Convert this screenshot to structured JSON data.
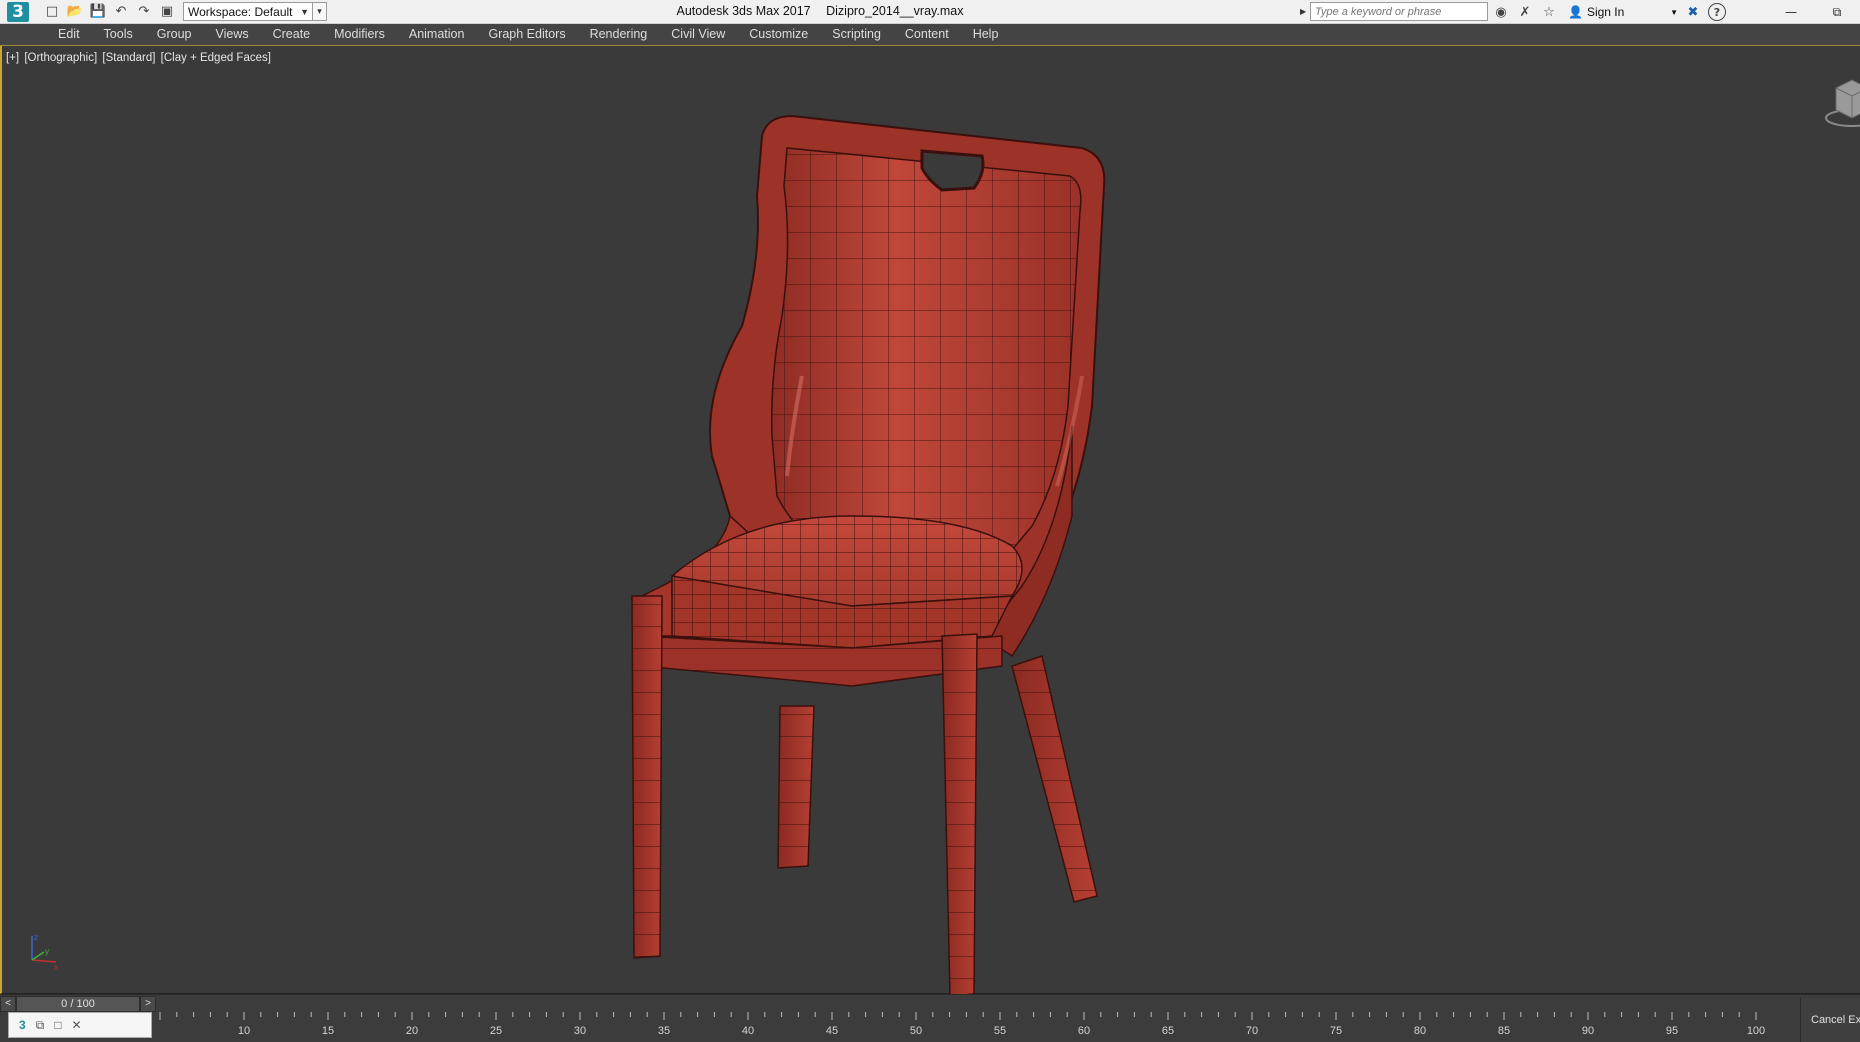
{
  "app": {
    "title": "Autodesk 3ds Max 2017",
    "filename": "Dizipro_2014__vray.max",
    "logo_text": "3"
  },
  "toolbar": {
    "workspace_label": "Workspace: Default",
    "search_placeholder": "Type a keyword or phrase",
    "sign_in_label": "Sign In",
    "help_label": "?"
  },
  "menu": {
    "items": [
      "Edit",
      "Tools",
      "Group",
      "Views",
      "Create",
      "Modifiers",
      "Animation",
      "Graph Editors",
      "Rendering",
      "Civil View",
      "Customize",
      "Scripting",
      "Content",
      "Help"
    ]
  },
  "viewport": {
    "label_plus": "[+]",
    "label_view": "[Orthographic]",
    "label_shading_std": "[Standard]",
    "label_shading": "[Clay + Edged Faces]"
  },
  "timeline": {
    "frame_display": "0 / 100",
    "prev": "<",
    "next": ">",
    "ticks": [
      10,
      15,
      20,
      25,
      30,
      35,
      40,
      45,
      50,
      55,
      60,
      65,
      70,
      75,
      80,
      85,
      90,
      95,
      100
    ],
    "cancel_label": "Cancel Exp"
  },
  "colors": {
    "accent": "#c9a830",
    "chair": "#b13a2e",
    "viewport_bg": "#3a3a3a"
  }
}
